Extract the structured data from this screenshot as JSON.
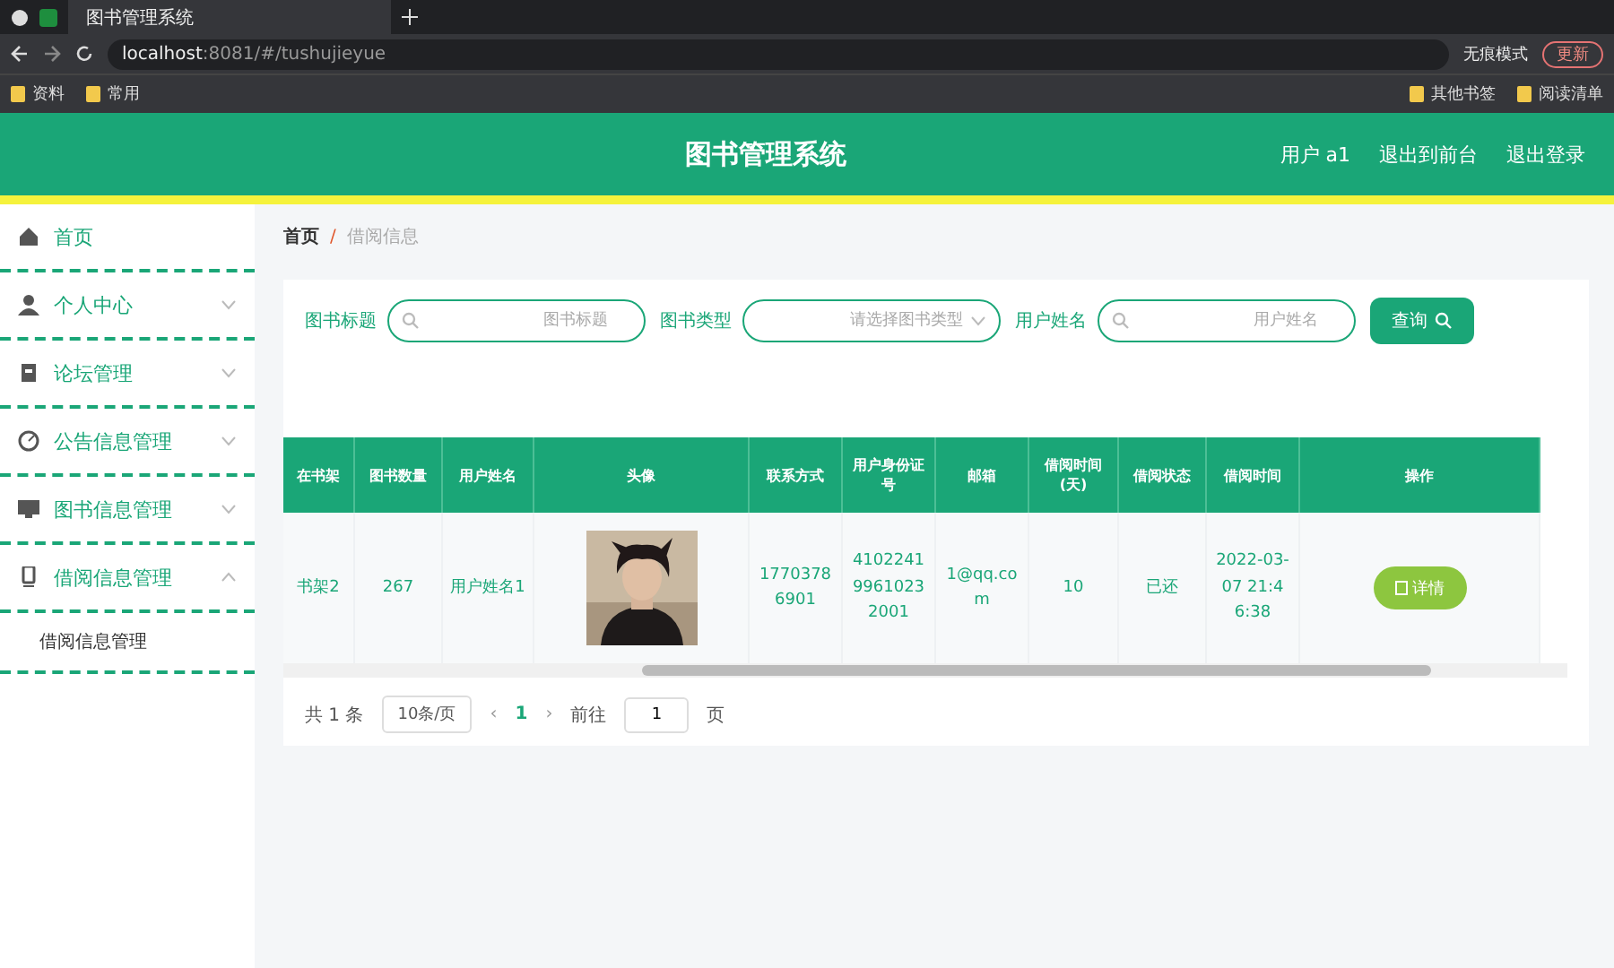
{
  "browser": {
    "tabs": [
      {
        "title": "图书管理系统",
        "selected": true
      }
    ],
    "url_host": "localhost",
    "url_rest": ":8081/#/tushujieyue",
    "incognito": "无痕模式",
    "update": "更新",
    "bookmarks": [
      "资料",
      "常用"
    ],
    "bookmarks_right": [
      "其他书签",
      "阅读清单"
    ]
  },
  "header": {
    "title": "图书管理系统",
    "links": [
      "用户 a1",
      "退出到前台",
      "退出登录"
    ]
  },
  "sidebar": {
    "items": [
      {
        "label": "首页",
        "kind": "link"
      },
      {
        "label": "个人中心",
        "kind": "group",
        "expanded": false
      },
      {
        "label": "论坛管理",
        "kind": "group",
        "expanded": false
      },
      {
        "label": "公告信息管理",
        "kind": "group",
        "expanded": false
      },
      {
        "label": "图书信息管理",
        "kind": "group",
        "expanded": false
      },
      {
        "label": "借阅信息管理",
        "kind": "group",
        "expanded": true,
        "children": [
          {
            "label": "借阅信息管理"
          }
        ]
      }
    ]
  },
  "breadcrumb": [
    "首页",
    "/",
    "借阅信息"
  ],
  "search": {
    "fields": [
      {
        "label": "图书标题",
        "kind": "text",
        "placeholder": "图书标题"
      },
      {
        "label": "图书类型",
        "kind": "select",
        "placeholder": "请选择图书类型"
      },
      {
        "label": "用户姓名",
        "kind": "text",
        "placeholder": "用户姓名"
      }
    ],
    "button": "查询"
  },
  "table": {
    "columns": [
      "在书架",
      "图书数量",
      "用户姓名",
      "头像",
      "联系方式",
      "用户身份证号",
      "邮箱",
      "借阅时间(天)",
      "借阅状态",
      "借阅时间",
      "操作"
    ],
    "rows": [
      {
        "cells": [
          "书架2",
          "267",
          "用户姓名1",
          null,
          "17703786901",
          "410224199610232001",
          "1@qq.com",
          "10",
          "已还",
          "2022-03-07 21:46:38"
        ],
        "action": "详情"
      }
    ]
  },
  "pagination": {
    "total": "共 1 条",
    "page_size": "10条/页",
    "prev": "‹",
    "pages": [
      {
        "label": "1",
        "selected": true
      }
    ],
    "next": "›",
    "goto": "前往",
    "goto_value": "1",
    "goto_unit": "页"
  }
}
